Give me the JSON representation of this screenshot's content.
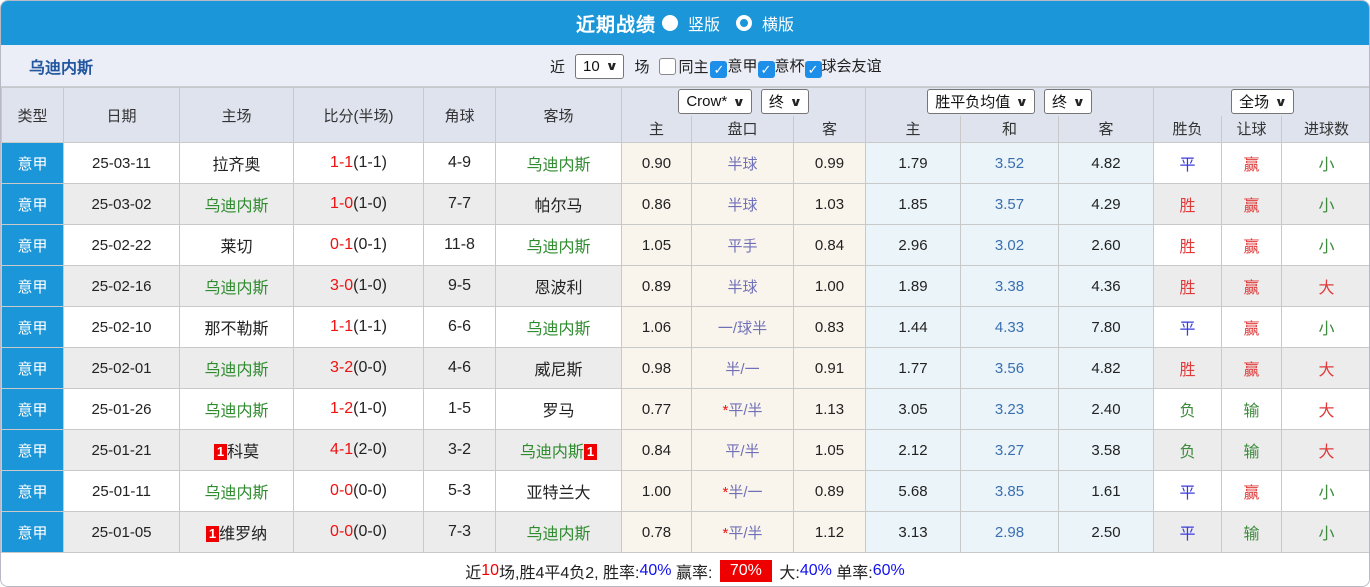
{
  "titlebar": {
    "title": "近期战绩",
    "radio_vertical": "竖版",
    "radio_horizontal": "横版"
  },
  "filter": {
    "team": "乌迪内斯",
    "recent_label": "近",
    "recent_value": "10",
    "games_label": "场",
    "same_home": {
      "label": "同主",
      "checked": false
    },
    "leagues": [
      {
        "label": "意甲",
        "checked": true
      },
      {
        "label": "意杯",
        "checked": true
      },
      {
        "label": "球会友谊",
        "checked": true
      }
    ]
  },
  "table": {
    "headers": {
      "type": "类型",
      "date": "日期",
      "home": "主场",
      "score": "比分(半场)",
      "corner": "角球",
      "away": "客场"
    },
    "sub_headers": [
      "主",
      "盘口",
      "客",
      "主",
      "和",
      "客",
      "胜负",
      "让球",
      "进球数"
    ],
    "dropdowns": {
      "bookmaker": "Crow*",
      "bookmaker_time": "终",
      "avg": "胜平负均值",
      "avg_time": "终",
      "scope": "全场"
    },
    "rows": [
      {
        "league": "意甲",
        "date": "25-03-11",
        "home_redcard": "",
        "home": "拉齐奥",
        "home_focus": false,
        "score_full": "1-1",
        "score_half": "(1-1)",
        "corners": "4-9",
        "away": "乌迪内斯",
        "away_focus": true,
        "away_redcard": "",
        "odds_home": "0.90",
        "handicap_star": "",
        "handicap": "半球",
        "odds_away": "0.99",
        "avg_home": "1.79",
        "avg_draw": "3.52",
        "avg_away": "4.82",
        "result": "平",
        "result_color": "blue",
        "handicap_result": "赢",
        "hr_color": "red",
        "goals": "小",
        "goals_color": "green"
      },
      {
        "league": "意甲",
        "date": "25-03-02",
        "home_redcard": "",
        "home": "乌迪内斯",
        "home_focus": true,
        "score_full": "1-0",
        "score_half": "(1-0)",
        "corners": "7-7",
        "away": "帕尔马",
        "away_focus": false,
        "away_redcard": "",
        "odds_home": "0.86",
        "handicap_star": "",
        "handicap": "半球",
        "odds_away": "1.03",
        "avg_home": "1.85",
        "avg_draw": "3.57",
        "avg_away": "4.29",
        "result": "胜",
        "result_color": "red",
        "handicap_result": "赢",
        "hr_color": "red",
        "goals": "小",
        "goals_color": "green"
      },
      {
        "league": "意甲",
        "date": "25-02-22",
        "home_redcard": "",
        "home": "莱切",
        "home_focus": false,
        "score_full": "0-1",
        "score_half": "(0-1)",
        "corners": "11-8",
        "away": "乌迪内斯",
        "away_focus": true,
        "away_redcard": "",
        "odds_home": "1.05",
        "handicap_star": "",
        "handicap": "平手",
        "odds_away": "0.84",
        "avg_home": "2.96",
        "avg_draw": "3.02",
        "avg_away": "2.60",
        "result": "胜",
        "result_color": "red",
        "handicap_result": "赢",
        "hr_color": "red",
        "goals": "小",
        "goals_color": "green"
      },
      {
        "league": "意甲",
        "date": "25-02-16",
        "home_redcard": "",
        "home": "乌迪内斯",
        "home_focus": true,
        "score_full": "3-0",
        "score_half": "(1-0)",
        "corners": "9-5",
        "away": "恩波利",
        "away_focus": false,
        "away_redcard": "",
        "odds_home": "0.89",
        "handicap_star": "",
        "handicap": "半球",
        "odds_away": "1.00",
        "avg_home": "1.89",
        "avg_draw": "3.38",
        "avg_away": "4.36",
        "result": "胜",
        "result_color": "red",
        "handicap_result": "赢",
        "hr_color": "red",
        "goals": "大",
        "goals_color": "red"
      },
      {
        "league": "意甲",
        "date": "25-02-10",
        "home_redcard": "",
        "home": "那不勒斯",
        "home_focus": false,
        "score_full": "1-1",
        "score_half": "(1-1)",
        "corners": "6-6",
        "away": "乌迪内斯",
        "away_focus": true,
        "away_redcard": "",
        "odds_home": "1.06",
        "handicap_star": "",
        "handicap": "一/球半",
        "odds_away": "0.83",
        "avg_home": "1.44",
        "avg_draw": "4.33",
        "avg_away": "7.80",
        "result": "平",
        "result_color": "blue",
        "handicap_result": "赢",
        "hr_color": "red",
        "goals": "小",
        "goals_color": "green"
      },
      {
        "league": "意甲",
        "date": "25-02-01",
        "home_redcard": "",
        "home": "乌迪内斯",
        "home_focus": true,
        "score_full": "3-2",
        "score_half": "(0-0)",
        "corners": "4-6",
        "away": "威尼斯",
        "away_focus": false,
        "away_redcard": "",
        "odds_home": "0.98",
        "handicap_star": "",
        "handicap": "半/一",
        "odds_away": "0.91",
        "avg_home": "1.77",
        "avg_draw": "3.56",
        "avg_away": "4.82",
        "result": "胜",
        "result_color": "red",
        "handicap_result": "赢",
        "hr_color": "red",
        "goals": "大",
        "goals_color": "red"
      },
      {
        "league": "意甲",
        "date": "25-01-26",
        "home_redcard": "",
        "home": "乌迪内斯",
        "home_focus": true,
        "score_full": "1-2",
        "score_half": "(1-0)",
        "corners": "1-5",
        "away": "罗马",
        "away_focus": false,
        "away_redcard": "",
        "odds_home": "0.77",
        "handicap_star": "*",
        "handicap": "平/半",
        "odds_away": "1.13",
        "avg_home": "3.05",
        "avg_draw": "3.23",
        "avg_away": "2.40",
        "result": "负",
        "result_color": "green",
        "handicap_result": "输",
        "hr_color": "green",
        "goals": "大",
        "goals_color": "red"
      },
      {
        "league": "意甲",
        "date": "25-01-21",
        "home_redcard": "1",
        "home": "科莫",
        "home_focus": false,
        "score_full": "4-1",
        "score_half": "(2-0)",
        "corners": "3-2",
        "away": "乌迪内斯",
        "away_focus": true,
        "away_redcard": "1",
        "odds_home": "0.84",
        "handicap_star": "",
        "handicap": "平/半",
        "odds_away": "1.05",
        "avg_home": "2.12",
        "avg_draw": "3.27",
        "avg_away": "3.58",
        "result": "负",
        "result_color": "green",
        "handicap_result": "输",
        "hr_color": "green",
        "goals": "大",
        "goals_color": "red"
      },
      {
        "league": "意甲",
        "date": "25-01-11",
        "home_redcard": "",
        "home": "乌迪内斯",
        "home_focus": true,
        "score_full": "0-0",
        "score_half": "(0-0)",
        "corners": "5-3",
        "away": "亚特兰大",
        "away_focus": false,
        "away_redcard": "",
        "odds_home": "1.00",
        "handicap_star": "*",
        "handicap": "半/一",
        "odds_away": "0.89",
        "avg_home": "5.68",
        "avg_draw": "3.85",
        "avg_away": "1.61",
        "result": "平",
        "result_color": "blue",
        "handicap_result": "赢",
        "hr_color": "red",
        "goals": "小",
        "goals_color": "green"
      },
      {
        "league": "意甲",
        "date": "25-01-05",
        "home_redcard": "1",
        "home": "维罗纳",
        "home_focus": false,
        "score_full": "0-0",
        "score_half": "(0-0)",
        "corners": "7-3",
        "away": "乌迪内斯",
        "away_focus": true,
        "away_redcard": "",
        "odds_home": "0.78",
        "handicap_star": "*",
        "handicap": "平/半",
        "odds_away": "1.12",
        "avg_home": "3.13",
        "avg_draw": "2.98",
        "avg_away": "2.50",
        "result": "平",
        "result_color": "blue",
        "handicap_result": "输",
        "hr_color": "green",
        "goals": "小",
        "goals_color": "green"
      }
    ]
  },
  "footer": {
    "parts": [
      {
        "t": "近",
        "c": "dark"
      },
      {
        "t": "10",
        "c": "red"
      },
      {
        "t": "场,胜4平4负2, 胜率:",
        "c": "dark"
      },
      {
        "t": "40%",
        "c": "blue"
      },
      {
        "t": " 赢率: ",
        "c": "dark"
      },
      {
        "t": "70%",
        "c": "badge"
      },
      {
        "t": " 大:",
        "c": "dark"
      },
      {
        "t": "40%",
        "c": "blue"
      },
      {
        "t": " 单率:",
        "c": "dark"
      },
      {
        "t": "60%",
        "c": "blue"
      }
    ]
  },
  "colors": {
    "accent_blue": "#1b96d8",
    "focus_team_green": "#2e8b2e",
    "score_red": "#ee1111",
    "handicap_purple": "#7070b8",
    "draw_odds_blue": "#3b6fb0",
    "badge_red": "#ee0000"
  }
}
